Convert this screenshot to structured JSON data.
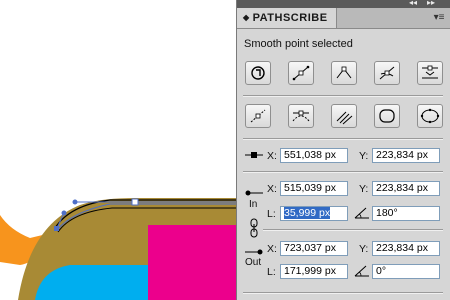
{
  "panel": {
    "title": "PATHSCRIBE",
    "tab_arrow": "◆",
    "menu_icon": "▾≡",
    "collapse_icon": "◂◂",
    "close_icon": "▸▸"
  },
  "status": "Smooth point selected",
  "toolbar_row1": [
    "convert-point-icon",
    "make-straight-icon",
    "make-corner-icon",
    "smooth-point-icon",
    "align-handles-icon"
  ],
  "toolbar_row2": [
    "retract-handles-icon",
    "symmetric-handles-icon",
    "extend-handles-icon",
    "circle-path-icon",
    "ellipse-path-icon"
  ],
  "point": {
    "x_label": "X:",
    "x_value": "551,038 px",
    "y_label": "Y:",
    "y_value": "223,834 px"
  },
  "in_handle": {
    "section_label": "In",
    "x_label": "X:",
    "x_value": "515,039 px",
    "y_label": "Y:",
    "y_value": "223,834 px",
    "length_label": "L:",
    "length_value": "35,999 px",
    "angle_value": "180°"
  },
  "out_handle": {
    "section_label": "Out",
    "x_label": "X:",
    "x_value": "723,037 px",
    "y_label": "Y:",
    "y_value": "223,834 px",
    "length_label": "L:",
    "length_value": "171,999 px",
    "angle_value": "0°"
  },
  "colors": {
    "panel_bg": "#d6d6d6",
    "shape_brown": "#a88a35",
    "shape_orange": "#f7941d",
    "shape_cyan": "#00aeef",
    "shape_magenta": "#ec008c",
    "selection_blue": "#4f6fc7",
    "field_selection": "#316ac5"
  }
}
